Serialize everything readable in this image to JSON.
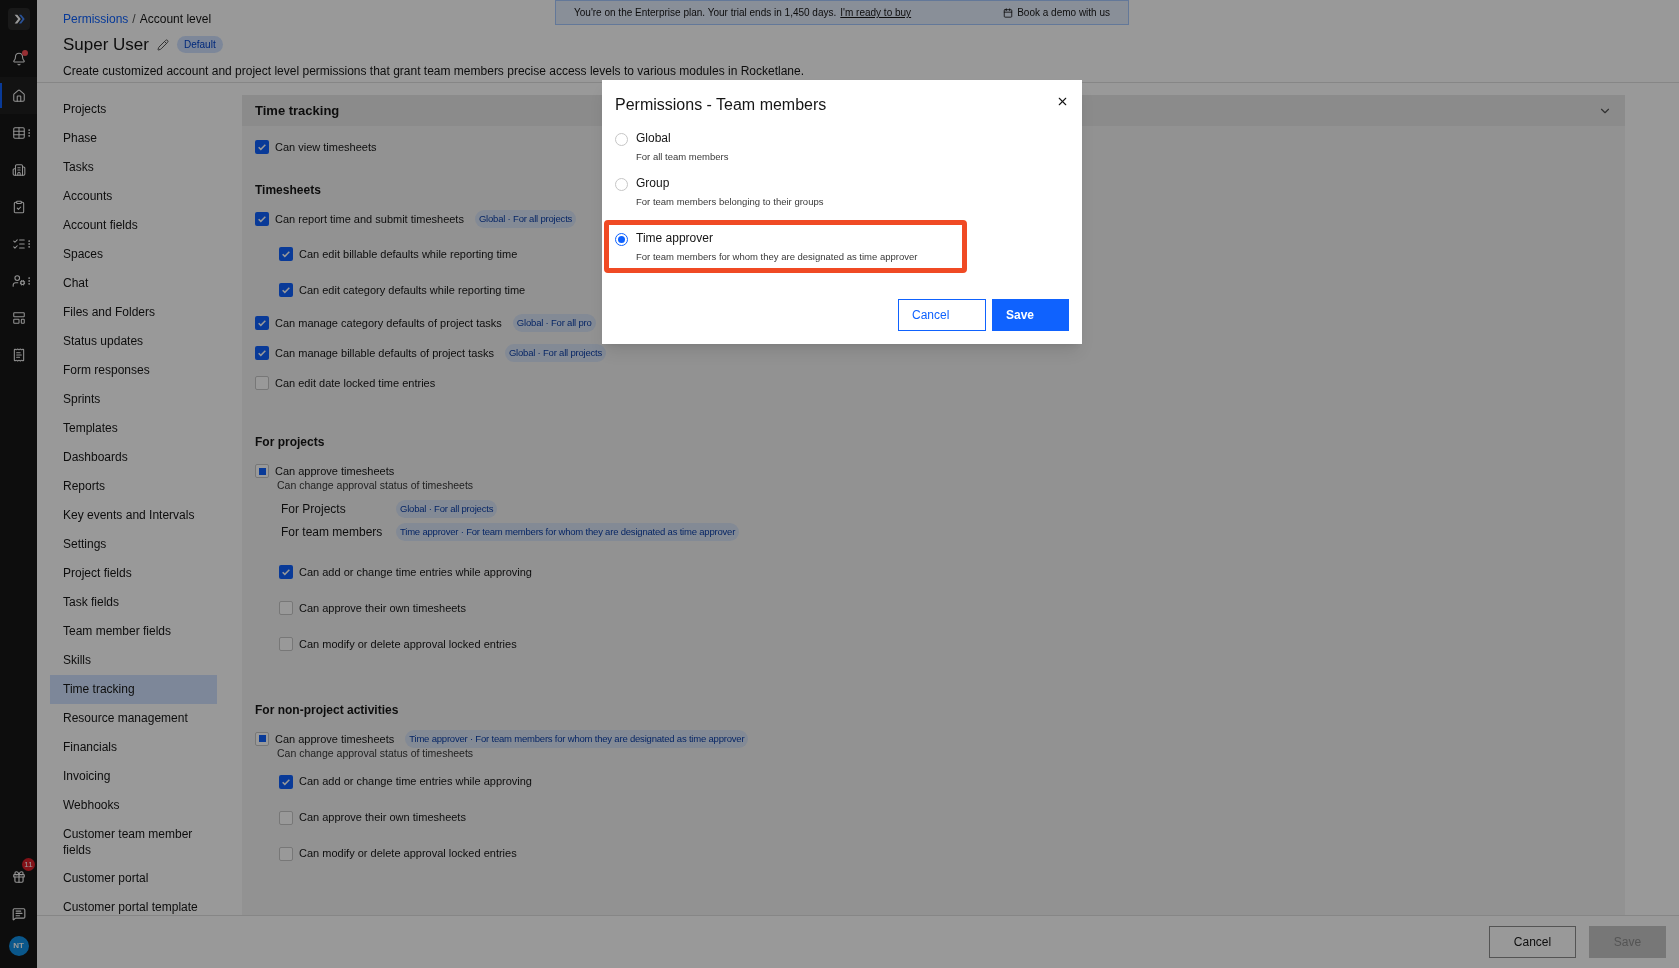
{
  "banner": {
    "text": "You're on the Enterprise plan. Your trial ends in 1,450 days.",
    "link": "I'm ready to buy",
    "demo": "Book a demo with us"
  },
  "rail": {
    "top": [
      {
        "kind": "bell",
        "selected": false,
        "more": false,
        "dot": true
      },
      {
        "kind": "home",
        "selected": true,
        "more": false,
        "dot": false
      },
      {
        "kind": "table",
        "selected": false,
        "more": true,
        "dot": false
      },
      {
        "kind": "building",
        "selected": false,
        "more": false,
        "dot": false
      },
      {
        "kind": "clipboard",
        "selected": false,
        "more": false,
        "dot": false
      },
      {
        "kind": "checklist",
        "selected": false,
        "more": true,
        "dot": false
      },
      {
        "kind": "usergear",
        "selected": false,
        "more": true,
        "dot": false
      },
      {
        "kind": "layout",
        "selected": false,
        "more": false,
        "dot": false
      },
      {
        "kind": "receipt",
        "selected": false,
        "more": false,
        "dot": false
      }
    ],
    "gift_badge": "11",
    "avatar": "NT"
  },
  "breadcrumb": {
    "parent": "Permissions",
    "separator": "/",
    "current": "Account level"
  },
  "title": "Super User",
  "title_badge": "Default",
  "description": "Create customized account and project level permissions that grant team members precise access levels to various modules in Rocketlane.",
  "nav": [
    {
      "label": "Projects",
      "selected": false
    },
    {
      "label": "Phase",
      "selected": false
    },
    {
      "label": "Tasks",
      "selected": false
    },
    {
      "label": "Accounts",
      "selected": false
    },
    {
      "label": "Account fields",
      "selected": false
    },
    {
      "label": "Spaces",
      "selected": false
    },
    {
      "label": "Chat",
      "selected": false
    },
    {
      "label": "Files and Folders",
      "selected": false
    },
    {
      "label": "Status updates",
      "selected": false
    },
    {
      "label": "Form responses",
      "selected": false
    },
    {
      "label": "Sprints",
      "selected": false
    },
    {
      "label": "Templates",
      "selected": false
    },
    {
      "label": "Dashboards",
      "selected": false
    },
    {
      "label": "Reports",
      "selected": false
    },
    {
      "label": "Key events and Intervals",
      "selected": false
    },
    {
      "label": "Settings",
      "selected": false
    },
    {
      "label": "Project fields",
      "selected": false
    },
    {
      "label": "Task fields",
      "selected": false
    },
    {
      "label": "Team member fields",
      "selected": false
    },
    {
      "label": "Skills",
      "selected": false
    },
    {
      "label": "Time tracking",
      "selected": true
    },
    {
      "label": "Resource management",
      "selected": false
    },
    {
      "label": "Financials",
      "selected": false
    },
    {
      "label": "Invoicing",
      "selected": false
    },
    {
      "label": "Webhooks",
      "selected": false
    },
    {
      "label": "Customer team member fields",
      "selected": false
    },
    {
      "label": "Customer portal",
      "selected": false
    },
    {
      "label": "Customer portal template",
      "selected": false
    }
  ],
  "section": {
    "title": "Time tracking",
    "expanded": true,
    "groups": [
      {
        "rows": [
          {
            "label": "Can view timesheets",
            "checked": true,
            "indeterminate": false
          }
        ]
      },
      {
        "heading": "Timesheets",
        "rows": [
          {
            "label": "Can report time and submit timesheets",
            "checked": true,
            "indeterminate": false,
            "badge": "Global · For all projects",
            "children": [
              {
                "label": "Can edit billable defaults while reporting time",
                "checked": true,
                "indeterminate": false
              },
              {
                "label": "Can edit category defaults while reporting time",
                "checked": true,
                "indeterminate": false
              }
            ]
          },
          {
            "label": "Can manage category defaults of project tasks",
            "checked": true,
            "indeterminate": false,
            "badge": "Global · For all pro"
          },
          {
            "label": "Can manage billable defaults of project tasks",
            "checked": true,
            "indeterminate": false,
            "badge": "Global · For all projects"
          },
          {
            "label": "Can edit date locked time entries",
            "checked": false,
            "indeterminate": false
          }
        ]
      },
      {
        "heading": "For projects",
        "rows": [
          {
            "label": "Can approve timesheets",
            "checked": false,
            "indeterminate": true,
            "hint": "Can change approval status of timesheets",
            "scopes": [
              {
                "label": "For Projects",
                "badge": "Global · For all projects"
              },
              {
                "label": "For team members",
                "badge": "Time approver · For team members for whom they are designated as time approver"
              }
            ],
            "children": [
              {
                "label": "Can add or change time entries while approving",
                "checked": true,
                "indeterminate": false
              },
              {
                "label": "Can approve their own timesheets",
                "checked": false,
                "indeterminate": false
              },
              {
                "label": "Can modify or delete approval locked entries",
                "checked": false,
                "indeterminate": false
              }
            ]
          }
        ]
      },
      {
        "heading": "For non-project activities",
        "rows": [
          {
            "label": "Can approve timesheets",
            "checked": false,
            "indeterminate": true,
            "badge": "Time approver · For team members for whom they are designated as time approver",
            "hint": "Can change approval status of timesheets",
            "children": [
              {
                "label": "Can add or change time entries while approving",
                "checked": true,
                "indeterminate": false
              },
              {
                "label": "Can approve their own timesheets",
                "checked": false,
                "indeterminate": false
              },
              {
                "label": "Can modify or delete approval locked entries",
                "checked": false,
                "indeterminate": false
              }
            ]
          }
        ]
      }
    ]
  },
  "footer": {
    "cancel": "Cancel",
    "save": "Save",
    "save_disabled": true
  },
  "modal": {
    "title": "Permissions - Team members",
    "options": [
      {
        "label": "Global",
        "description": "For all team members",
        "selected": false,
        "highlighted": false
      },
      {
        "label": "Group",
        "description": "For team members belonging to their groups",
        "selected": false,
        "highlighted": false
      },
      {
        "label": "Time approver",
        "description": "For team members for whom they are designated as time approver",
        "selected": true,
        "highlighted": true
      }
    ],
    "cancel": "Cancel",
    "save": "Save"
  }
}
